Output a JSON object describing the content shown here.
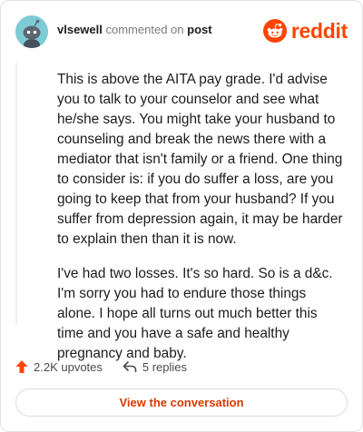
{
  "header": {
    "username": "vlsewell",
    "action_text": "commented on",
    "target_text": "post",
    "brand_name": "reddit"
  },
  "comment": {
    "paragraphs": [
      "This is above the AITA pay grade. I'd advise you to talk to your counselor and see what he/she says. You might take your husband to counseling and break the news there with a mediator that isn't family or a friend. One thing to consider is: if you do suffer a loss, are you going to keep that from your husband? If you suffer from depression again, it may be harder to explain then than it is now.",
      "I've had two losses. It's so hard. So is a d&c. I'm sorry you had to endure those things alone. I hope all turns out much better this time and you have a safe and healthy pregnancy and baby."
    ]
  },
  "footer": {
    "upvotes": "2.2K upvotes",
    "replies": "5 replies",
    "view_button": "View the conversation"
  },
  "colors": {
    "brand": "#ff4500",
    "link": "#d93a00",
    "avatar_bg": "#7ecbd6"
  },
  "icons": {
    "avatar": "snoo-avatar-icon",
    "brand": "reddit-logo-icon",
    "upvote": "upvote-arrow-icon",
    "reply": "reply-arrow-icon"
  }
}
